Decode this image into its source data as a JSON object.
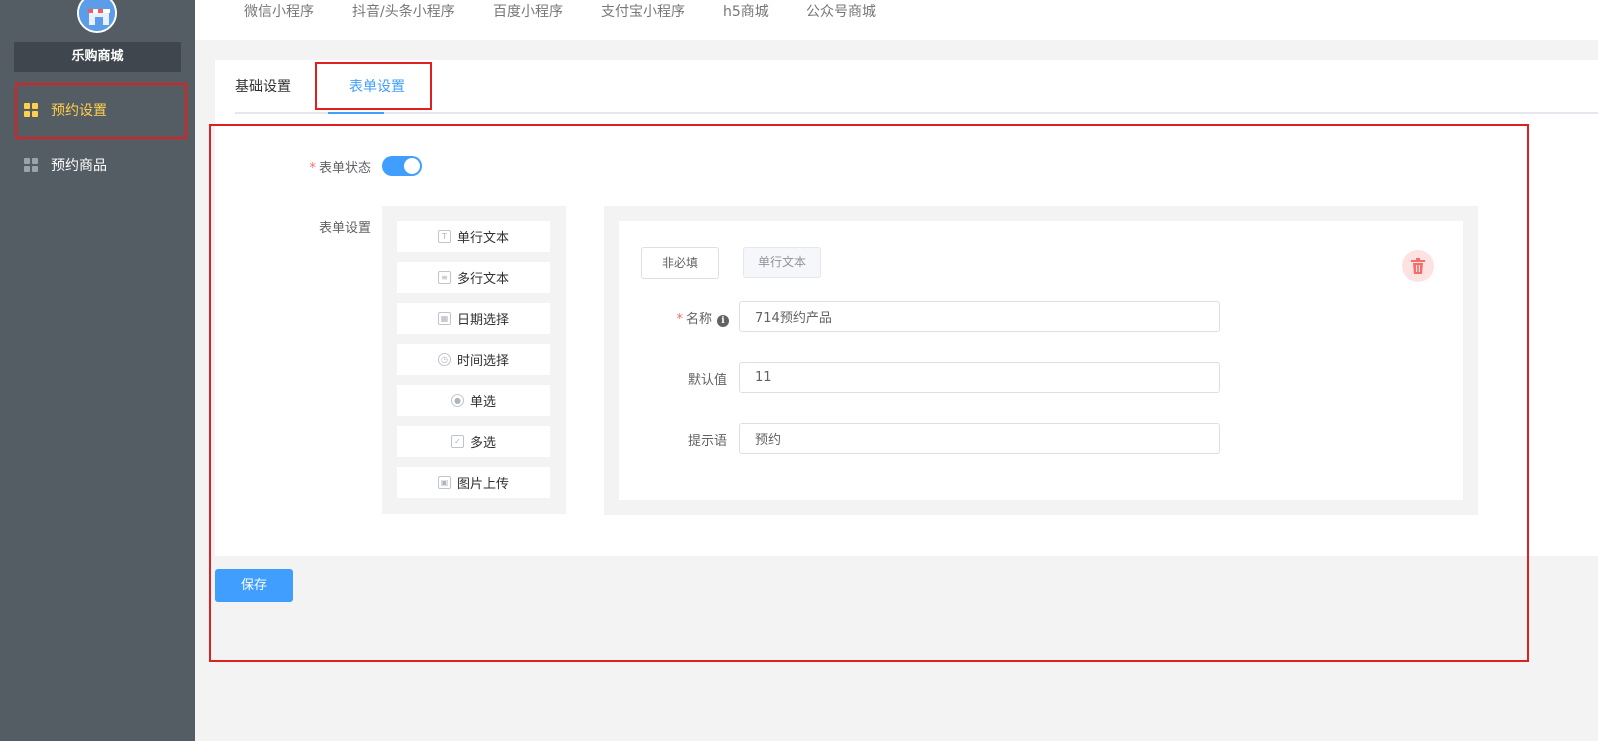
{
  "sidebar": {
    "shop_name": "乐购商城",
    "items": [
      {
        "label": "预约设置",
        "icon": "grid-icon",
        "active": true
      },
      {
        "label": "预约商品",
        "icon": "grid-icon",
        "active": false
      }
    ]
  },
  "platform_tabs": [
    "微信小程序",
    "抖音/头条小程序",
    "百度小程序",
    "支付宝小程序",
    "h5商城",
    "公众号商城"
  ],
  "tabs": [
    {
      "label": "基础设置",
      "active": false
    },
    {
      "label": "表单设置",
      "active": true
    }
  ],
  "form": {
    "status_label": "表单状态",
    "status_on": true,
    "settings_label": "表单设置",
    "palette": [
      {
        "label": "单行文本",
        "icon": "text-icon"
      },
      {
        "label": "多行文本",
        "icon": "textarea-icon"
      },
      {
        "label": "日期选择",
        "icon": "calendar-icon"
      },
      {
        "label": "时间选择",
        "icon": "clock-icon"
      },
      {
        "label": "单选",
        "icon": "radio-icon"
      },
      {
        "label": "多选",
        "icon": "checkbox-icon"
      },
      {
        "label": "图片上传",
        "icon": "image-icon"
      }
    ],
    "editor": {
      "required_button": "非必填",
      "type_button": "单行文本",
      "name_label": "名称",
      "name_value": "714预约产品",
      "default_label": "默认值",
      "default_value": "11",
      "hint_label": "提示语",
      "hint_value": "预约"
    }
  },
  "save_label": "保存",
  "colors": {
    "sidebar": "#545c64",
    "active_menu": "#ffd04b",
    "primary": "#409eff",
    "highlight": "#e02020"
  }
}
